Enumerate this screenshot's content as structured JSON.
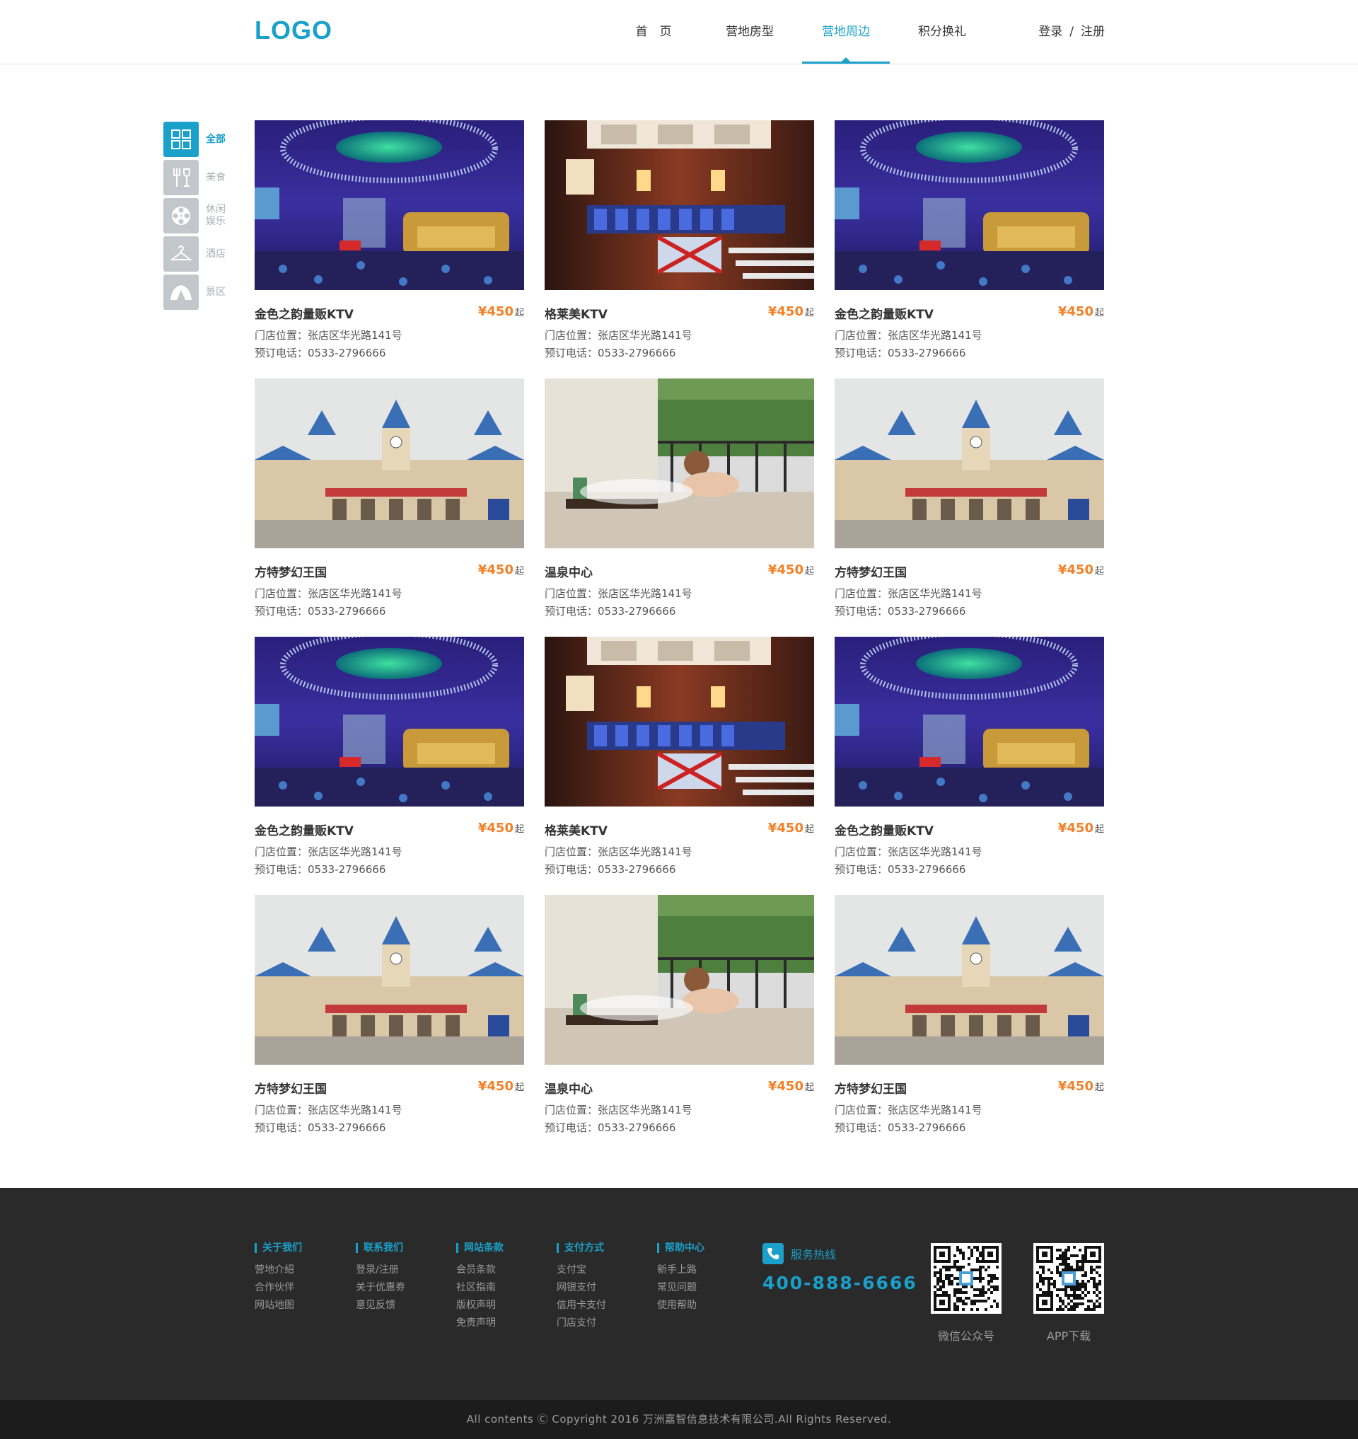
{
  "header": {
    "logo": "LOGO",
    "nav": [
      "首　页",
      "营地房型",
      "营地周边",
      "积分换礼"
    ],
    "active_nav": 2,
    "login": "登录",
    "separator": "/",
    "register": "注册"
  },
  "sidebar": {
    "items": [
      {
        "label": "全部",
        "icon": "grid-icon",
        "active": true
      },
      {
        "label": "美食",
        "icon": "dining-icon",
        "active": false
      },
      {
        "label": "休闲娱乐",
        "icon": "film-reel-icon",
        "active": false
      },
      {
        "label": "酒店",
        "icon": "hanger-icon",
        "active": false
      },
      {
        "label": "景区",
        "icon": "tent-icon",
        "active": false
      }
    ]
  },
  "cards": [
    {
      "name": "金色之韵量贩KTV",
      "price": "¥450",
      "suffix": "起",
      "address": "门店位置：张店区华光路141号",
      "phone": "预订电话：0533-2796666",
      "image": "ktv-blue"
    },
    {
      "name": "格莱美KTV",
      "price": "¥450",
      "suffix": "起",
      "address": "门店位置：张店区华光路141号",
      "phone": "预订电话：0533-2796666",
      "image": "ktv-warm"
    },
    {
      "name": "金色之韵量贩KTV",
      "price": "¥450",
      "suffix": "起",
      "address": "门店位置：张店区华光路141号",
      "phone": "预订电话：0533-2796666",
      "image": "ktv-blue"
    },
    {
      "name": "方特梦幻王国",
      "price": "¥450",
      "suffix": "起",
      "address": "门店位置：张店区华光路141号",
      "phone": "预订电话：0533-2796666",
      "image": "park"
    },
    {
      "name": "温泉中心",
      "price": "¥450",
      "suffix": "起",
      "address": "门店位置：张店区华光路141号",
      "phone": "预订电话：0533-2796666",
      "image": "spa"
    },
    {
      "name": "方特梦幻王国",
      "price": "¥450",
      "suffix": "起",
      "address": "门店位置：张店区华光路141号",
      "phone": "预订电话：0533-2796666",
      "image": "park"
    },
    {
      "name": "金色之韵量贩KTV",
      "price": "¥450",
      "suffix": "起",
      "address": "门店位置：张店区华光路141号",
      "phone": "预订电话：0533-2796666",
      "image": "ktv-blue"
    },
    {
      "name": "格莱美KTV",
      "price": "¥450",
      "suffix": "起",
      "address": "门店位置：张店区华光路141号",
      "phone": "预订电话：0533-2796666",
      "image": "ktv-warm"
    },
    {
      "name": "金色之韵量贩KTV",
      "price": "¥450",
      "suffix": "起",
      "address": "门店位置：张店区华光路141号",
      "phone": "预订电话：0533-2796666",
      "image": "ktv-blue"
    },
    {
      "name": "方特梦幻王国",
      "price": "¥450",
      "suffix": "起",
      "address": "门店位置：张店区华光路141号",
      "phone": "预订电话：0533-2796666",
      "image": "park"
    },
    {
      "name": "温泉中心",
      "price": "¥450",
      "suffix": "起",
      "address": "门店位置：张店区华光路141号",
      "phone": "预订电话：0533-2796666",
      "image": "spa"
    },
    {
      "name": "方特梦幻王国",
      "price": "¥450",
      "suffix": "起",
      "address": "门店位置：张店区华光路141号",
      "phone": "预订电话：0533-2796666",
      "image": "park"
    }
  ],
  "footer": {
    "columns": [
      {
        "title": "关于我们",
        "links": [
          "营地介绍",
          "合作伙伴",
          "网站地图"
        ]
      },
      {
        "title": "联系我们",
        "links": [
          "登录/注册",
          "关于优惠券",
          "意见反馈"
        ]
      },
      {
        "title": "网站条款",
        "links": [
          "会员条款",
          "社区指南",
          "版权声明",
          "免责声明"
        ]
      },
      {
        "title": "支付方式",
        "links": [
          "支付宝",
          "网银支付",
          "信用卡支付",
          "门店支付"
        ]
      },
      {
        "title": "帮助中心",
        "links": [
          "新手上路",
          "常见问题",
          "使用帮助"
        ]
      }
    ],
    "hotline_label": "服务热线",
    "hotline_number": "400-888-6666",
    "qr_codes": [
      "微信公众号",
      "APP下载"
    ],
    "copyright": "All contents Ⓒ Copyright 2016 万洲嘉智信息技术有限公司.All Rights Reserved."
  },
  "colors": {
    "accent": "#1aa0c9",
    "price": "#f0822a",
    "footer_bg": "#2a2a2a"
  }
}
